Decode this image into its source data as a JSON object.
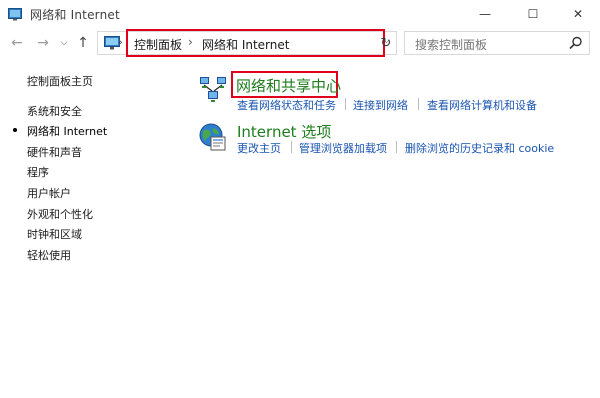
{
  "window": {
    "title": "网络和 Internet",
    "controls": {
      "minimize": "—",
      "maximize": "☐",
      "close": "✕"
    }
  },
  "nav": {
    "back_icon": "←",
    "forward_icon": "→",
    "dropdown_icon": "⌵",
    "up_icon": "↑"
  },
  "address": {
    "breadcrumbs": [
      "控制面板",
      "网络和 Internet"
    ],
    "separator": "›",
    "dropdown_icon": "⌵",
    "refresh_icon": "↻"
  },
  "search": {
    "placeholder": "搜索控制面板"
  },
  "sidebar": {
    "items": [
      {
        "label": "控制面板主页",
        "active": false
      },
      {
        "label": "系统和安全",
        "active": false
      },
      {
        "label": "网络和 Internet",
        "active": true
      },
      {
        "label": "硬件和声音",
        "active": false
      },
      {
        "label": "程序",
        "active": false
      },
      {
        "label": "用户帐户",
        "active": false
      },
      {
        "label": "外观和个性化",
        "active": false
      },
      {
        "label": "时钟和区域",
        "active": false
      },
      {
        "label": "轻松使用",
        "active": false
      }
    ]
  },
  "main": {
    "categories": [
      {
        "title": "网络和共享中心",
        "icon": "network-sharing-icon",
        "links": [
          "查看网络状态和任务",
          "连接到网络",
          "查看网络计算机和设备"
        ]
      },
      {
        "title": "Internet 选项",
        "icon": "internet-options-globe-icon",
        "links": [
          "更改主页",
          "管理浏览器加载项",
          "删除浏览的历史记录和 cookie"
        ]
      }
    ]
  },
  "colors": {
    "highlight_border": "#e0001b",
    "category_title": "#1e7d1e",
    "link": "#1a55b0"
  }
}
